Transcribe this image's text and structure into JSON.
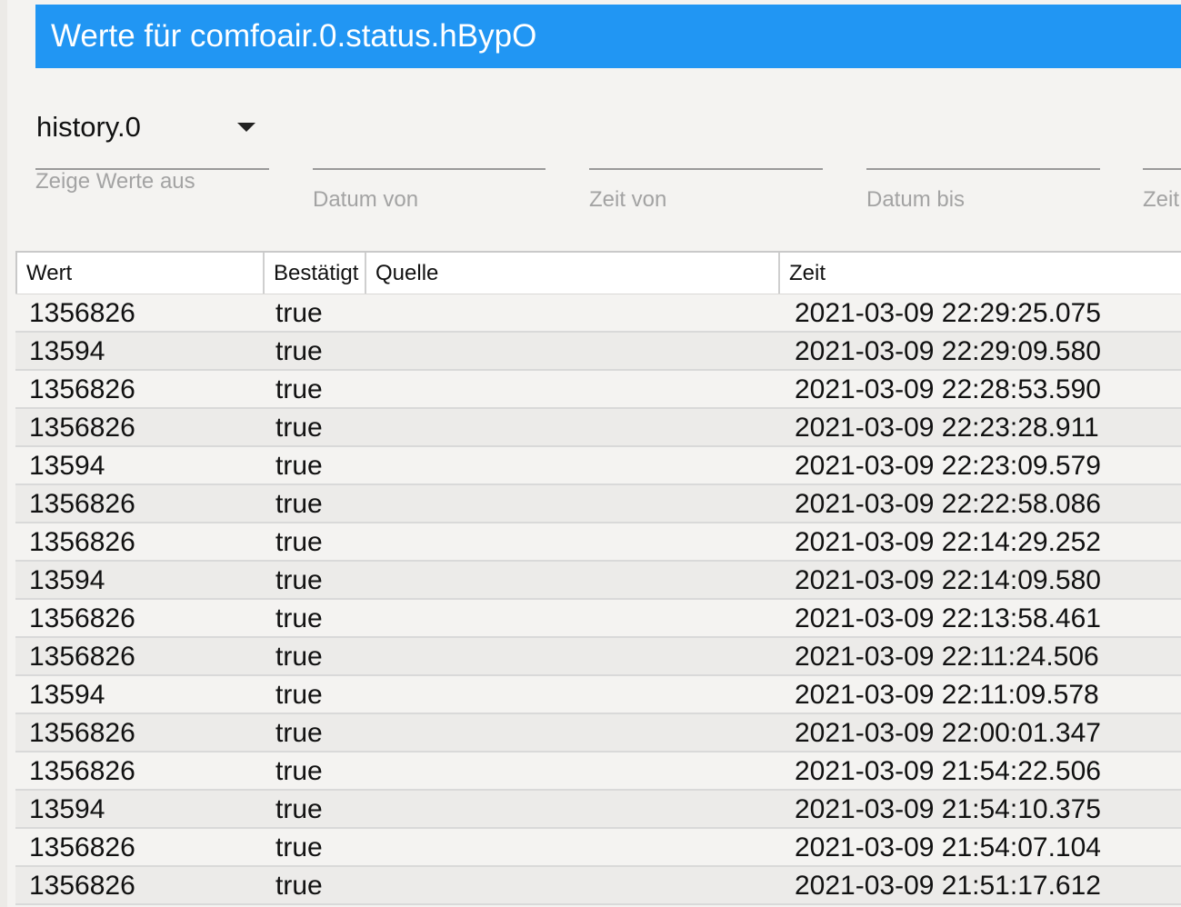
{
  "window": {
    "title": "Werte für comfoair.0.status.hBypO"
  },
  "filters": {
    "instance": {
      "value": "history.0",
      "label": "Zeige Werte aus"
    },
    "date_from_label": "Datum von",
    "time_from_label": "Zeit von",
    "date_to_label": "Datum bis",
    "time_to_label": "Zeit bis"
  },
  "table": {
    "columns": [
      "Wert",
      "Bestätigt",
      "Quelle",
      "Zeit"
    ],
    "rows": [
      {
        "wert": "1356826",
        "ack": "true",
        "quelle": "",
        "zeit": "2021-03-09 22:29:25.075"
      },
      {
        "wert": "13594",
        "ack": "true",
        "quelle": "",
        "zeit": "2021-03-09 22:29:09.580"
      },
      {
        "wert": "1356826",
        "ack": "true",
        "quelle": "",
        "zeit": "2021-03-09 22:28:53.590"
      },
      {
        "wert": "1356826",
        "ack": "true",
        "quelle": "",
        "zeit": "2021-03-09 22:23:28.911"
      },
      {
        "wert": "13594",
        "ack": "true",
        "quelle": "",
        "zeit": "2021-03-09 22:23:09.579"
      },
      {
        "wert": "1356826",
        "ack": "true",
        "quelle": "",
        "zeit": "2021-03-09 22:22:58.086"
      },
      {
        "wert": "1356826",
        "ack": "true",
        "quelle": "",
        "zeit": "2021-03-09 22:14:29.252"
      },
      {
        "wert": "13594",
        "ack": "true",
        "quelle": "",
        "zeit": "2021-03-09 22:14:09.580"
      },
      {
        "wert": "1356826",
        "ack": "true",
        "quelle": "",
        "zeit": "2021-03-09 22:13:58.461"
      },
      {
        "wert": "1356826",
        "ack": "true",
        "quelle": "",
        "zeit": "2021-03-09 22:11:24.506"
      },
      {
        "wert": "13594",
        "ack": "true",
        "quelle": "",
        "zeit": "2021-03-09 22:11:09.578"
      },
      {
        "wert": "1356826",
        "ack": "true",
        "quelle": "",
        "zeit": "2021-03-09 22:00:01.347"
      },
      {
        "wert": "1356826",
        "ack": "true",
        "quelle": "",
        "zeit": "2021-03-09 21:54:22.506"
      },
      {
        "wert": "13594",
        "ack": "true",
        "quelle": "",
        "zeit": "2021-03-09 21:54:10.375"
      },
      {
        "wert": "1356826",
        "ack": "true",
        "quelle": "",
        "zeit": "2021-03-09 21:54:07.104"
      },
      {
        "wert": "1356826",
        "ack": "true",
        "quelle": "",
        "zeit": "2021-03-09 21:51:17.612"
      }
    ]
  },
  "colors": {
    "title_bar": "#2196f3",
    "background": "#f4f3f1"
  }
}
